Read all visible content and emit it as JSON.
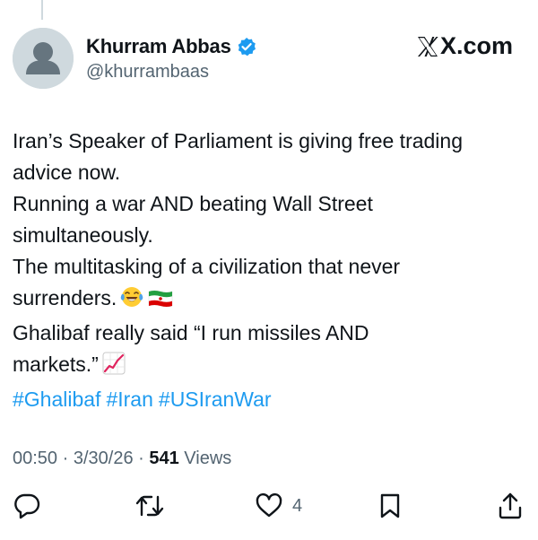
{
  "author": {
    "display_name": "Khurram Abbas",
    "handle": "@khurrambaas",
    "verified": true
  },
  "brand": {
    "label": "X.com"
  },
  "tweet": {
    "lines": [
      "Iran’s Speaker of Parliament is giving free trading",
      "advice now.",
      "Running a war AND beating Wall Street",
      "simultaneously.",
      "The multitasking of a civilization that never",
      "surrenders.",
      "Ghalibaf really said “I run missiles AND",
      "markets.”"
    ],
    "emojis": {
      "laughing": "tears-of-joy-emoji",
      "flag": "iran-flag-emoji",
      "chart": "chart-increasing-emoji"
    },
    "hashtags": [
      "#Ghalibaf",
      "#Iran",
      "#USIranWar"
    ]
  },
  "meta": {
    "time": "00:50",
    "date": "3/30/26",
    "views_count": "541",
    "views_label": "Views"
  },
  "actions": {
    "reply": {
      "icon": "reply-icon",
      "count": ""
    },
    "retweet": {
      "icon": "retweet-icon",
      "count": ""
    },
    "like": {
      "icon": "heart-icon",
      "count": "4"
    },
    "bookmark": {
      "icon": "bookmark-icon",
      "count": ""
    },
    "share": {
      "icon": "share-icon",
      "count": ""
    }
  },
  "colors": {
    "text": "#0f1419",
    "secondary": "#536471",
    "link": "#1d9bf0",
    "verified": "#1d9bf0"
  }
}
